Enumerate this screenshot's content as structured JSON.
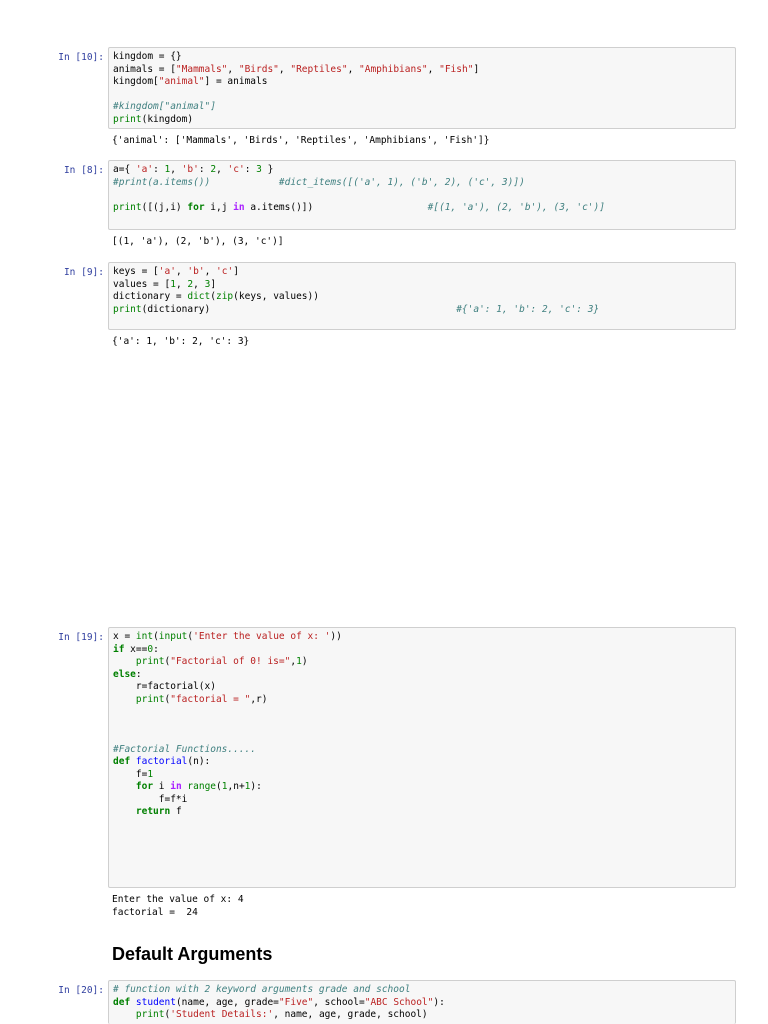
{
  "cells": [
    {
      "prompt": "In [10]:",
      "lines": [
        [
          [
            "t",
            "kingdom = {}"
          ]
        ],
        [
          [
            "t",
            "animals = ["
          ],
          [
            "st",
            "\"Mammals\""
          ],
          [
            "t",
            ", "
          ],
          [
            "st",
            "\"Birds\""
          ],
          [
            "t",
            ", "
          ],
          [
            "st",
            "\"Reptiles\""
          ],
          [
            "t",
            ", "
          ],
          [
            "st",
            "\"Amphibians\""
          ],
          [
            "t",
            ", "
          ],
          [
            "st",
            "\"Fish\""
          ],
          [
            "t",
            "]"
          ]
        ],
        [
          [
            "t",
            "kingdom["
          ],
          [
            "st",
            "\"animal\""
          ],
          [
            "t",
            "] = animals"
          ]
        ],
        [
          [
            "t",
            ""
          ]
        ],
        [
          [
            "cm",
            "#kingdom[\"animal\"]"
          ]
        ],
        [
          [
            "bi",
            "print"
          ],
          [
            "t",
            "(kingdom)"
          ]
        ]
      ],
      "output": "{'animal': ['Mammals', 'Birds', 'Reptiles', 'Amphibians', 'Fish']}"
    },
    {
      "prompt": "In [8]:",
      "lines": [
        [
          [
            "t",
            "a={ "
          ],
          [
            "st",
            "'a'"
          ],
          [
            "t",
            ": "
          ],
          [
            "nm",
            "1"
          ],
          [
            "t",
            ", "
          ],
          [
            "st",
            "'b'"
          ],
          [
            "t",
            ": "
          ],
          [
            "nm",
            "2"
          ],
          [
            "t",
            ", "
          ],
          [
            "st",
            "'c'"
          ],
          [
            "t",
            ": "
          ],
          [
            "nm",
            "3"
          ],
          [
            "t",
            " }"
          ]
        ],
        [
          [
            "cm",
            "#print(a.items())"
          ],
          [
            "t",
            "            "
          ],
          [
            "cm",
            "#dict_items([('a', 1), ('b', 2), ('c', 3)])"
          ]
        ],
        [
          [
            "t",
            ""
          ]
        ],
        [
          [
            "bi",
            "print"
          ],
          [
            "t",
            "([(j,i) "
          ],
          [
            "kw",
            "for"
          ],
          [
            "t",
            " i,j "
          ],
          [
            "op",
            "in"
          ],
          [
            "t",
            " a.items()])                    "
          ],
          [
            "cm",
            "#[(1, 'a'), (2, 'b'), (3, 'c')]"
          ]
        ]
      ],
      "output": "[(1, 'a'), (2, 'b'), (3, 'c')]"
    },
    {
      "prompt": "In [9]:",
      "lines": [
        [
          [
            "t",
            "keys = ["
          ],
          [
            "st",
            "'a'"
          ],
          [
            "t",
            ", "
          ],
          [
            "st",
            "'b'"
          ],
          [
            "t",
            ", "
          ],
          [
            "st",
            "'c'"
          ],
          [
            "t",
            "]"
          ]
        ],
        [
          [
            "t",
            "values = ["
          ],
          [
            "nm",
            "1"
          ],
          [
            "t",
            ", "
          ],
          [
            "nm",
            "2"
          ],
          [
            "t",
            ", "
          ],
          [
            "nm",
            "3"
          ],
          [
            "t",
            "]"
          ]
        ],
        [
          [
            "t",
            "dictionary = "
          ],
          [
            "bi",
            "dict"
          ],
          [
            "t",
            "("
          ],
          [
            "bi",
            "zip"
          ],
          [
            "t",
            "(keys, values))"
          ]
        ],
        [
          [
            "bi",
            "print"
          ],
          [
            "t",
            "(dictionary)                                           "
          ],
          [
            "cm",
            "#{'a': 1, 'b': 2, 'c': 3}"
          ]
        ]
      ],
      "output": "{'a': 1, 'b': 2, 'c': 3}"
    },
    {
      "prompt": "In [19]:",
      "lines": [
        [
          [
            "t",
            "x = "
          ],
          [
            "bi",
            "int"
          ],
          [
            "t",
            "("
          ],
          [
            "bi",
            "input"
          ],
          [
            "t",
            "("
          ],
          [
            "st",
            "'Enter the value of x: '"
          ],
          [
            "t",
            "))"
          ]
        ],
        [
          [
            "kw",
            "if"
          ],
          [
            "t",
            " x=="
          ],
          [
            "nm",
            "0"
          ],
          [
            "t",
            ":"
          ]
        ],
        [
          [
            "t",
            "    "
          ],
          [
            "bi",
            "print"
          ],
          [
            "t",
            "("
          ],
          [
            "st",
            "\"Factorial of 0! is=\""
          ],
          [
            "t",
            ","
          ],
          [
            "nm",
            "1"
          ],
          [
            "t",
            ")"
          ]
        ],
        [
          [
            "kw",
            "else"
          ],
          [
            "t",
            ":"
          ]
        ],
        [
          [
            "t",
            "    r=factorial(x)"
          ]
        ],
        [
          [
            "t",
            "    "
          ],
          [
            "bi",
            "print"
          ],
          [
            "t",
            "("
          ],
          [
            "st",
            "\"factorial = \""
          ],
          [
            "t",
            ",r)"
          ]
        ],
        [
          [
            "t",
            ""
          ]
        ],
        [
          [
            "t",
            ""
          ]
        ],
        [
          [
            "t",
            ""
          ]
        ],
        [
          [
            "cm",
            "#Factorial Functions....."
          ]
        ],
        [
          [
            "kw",
            "def"
          ],
          [
            "t",
            " "
          ],
          [
            "fn",
            "factorial"
          ],
          [
            "t",
            "(n):"
          ]
        ],
        [
          [
            "t",
            "    f="
          ],
          [
            "nm",
            "1"
          ]
        ],
        [
          [
            "t",
            "    "
          ],
          [
            "kw",
            "for"
          ],
          [
            "t",
            " i "
          ],
          [
            "op",
            "in"
          ],
          [
            "t",
            " "
          ],
          [
            "bi",
            "range"
          ],
          [
            "t",
            "("
          ],
          [
            "nm",
            "1"
          ],
          [
            "t",
            ",n+"
          ],
          [
            "nm",
            "1"
          ],
          [
            "t",
            "):"
          ]
        ],
        [
          [
            "t",
            "        f=f*i"
          ]
        ],
        [
          [
            "t",
            "    "
          ],
          [
            "kw",
            "return"
          ],
          [
            "t",
            " f"
          ]
        ]
      ],
      "output": "Enter the value of x: 4\nfactorial =  24"
    },
    {
      "prompt": "In [20]:",
      "lines": [
        [
          [
            "cm",
            "# function with 2 keyword arguments grade and school"
          ]
        ],
        [
          [
            "kw",
            "def"
          ],
          [
            "t",
            " "
          ],
          [
            "fn",
            "student"
          ],
          [
            "t",
            "(name, age, grade="
          ],
          [
            "st",
            "\"Five\""
          ],
          [
            "t",
            ", school="
          ],
          [
            "st",
            "\"ABC School\""
          ],
          [
            "t",
            "):"
          ]
        ],
        [
          [
            "t",
            "    "
          ],
          [
            "bi",
            "print"
          ],
          [
            "t",
            "("
          ],
          [
            "st",
            "'Student Details:'"
          ],
          [
            "t",
            ", name, age, grade, school)"
          ]
        ]
      ],
      "output": ""
    }
  ],
  "heading": "Default Arguments"
}
